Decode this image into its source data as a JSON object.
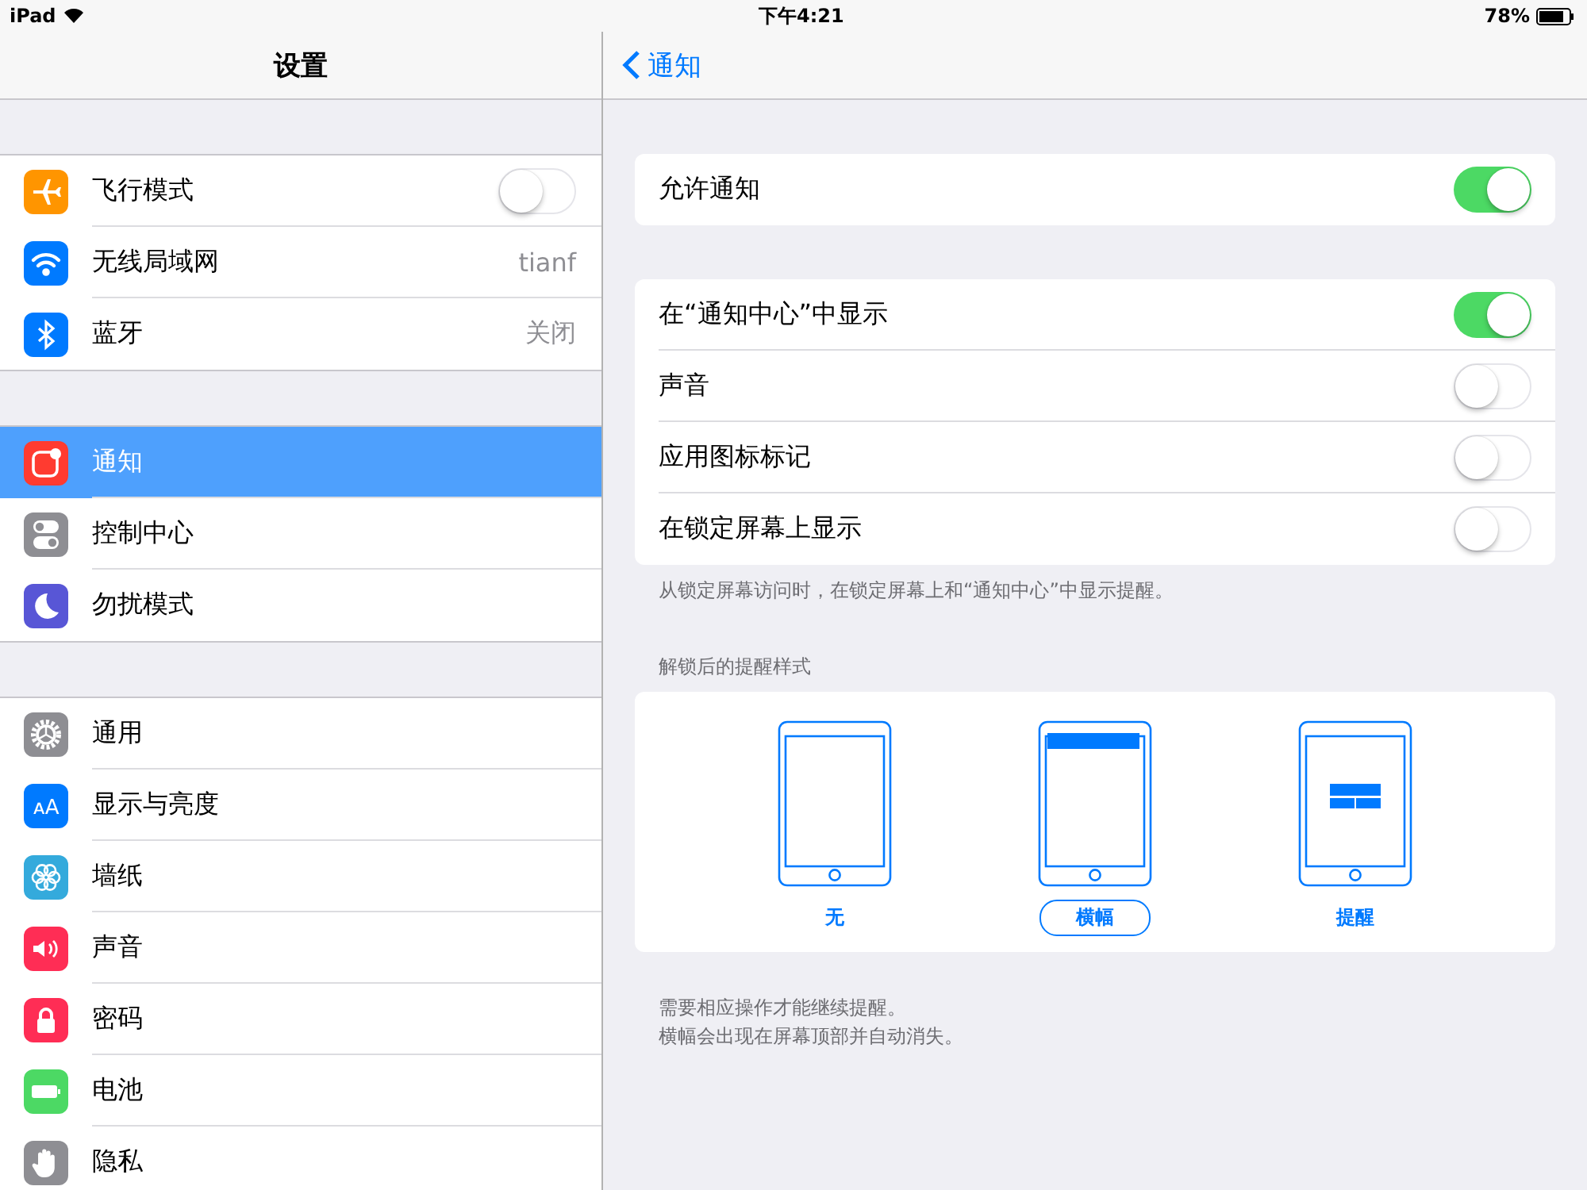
{
  "status_bar": {
    "device": "iPad",
    "time": "下午4:21",
    "battery": "78%"
  },
  "sidebar": {
    "title": "设置",
    "groups": [
      {
        "items": [
          {
            "label": "飞行模式",
            "kind": "toggle",
            "on": false,
            "selected": false,
            "color": "#ff9500"
          },
          {
            "label": "无线局域网",
            "kind": "detail",
            "value": "tianf",
            "selected": false,
            "color": "#007aff"
          },
          {
            "label": "蓝牙",
            "kind": "detail",
            "value": "关闭",
            "selected": false,
            "color": "#007aff"
          }
        ]
      },
      {
        "items": [
          {
            "label": "通知",
            "kind": "plain",
            "selected": true,
            "color": "#ff3b30"
          },
          {
            "label": "控制中心",
            "kind": "plain",
            "selected": false,
            "color": "#8e8e93"
          },
          {
            "label": "勿扰模式",
            "kind": "plain",
            "selected": false,
            "color": "#5856d6"
          }
        ]
      },
      {
        "items": [
          {
            "label": "通用",
            "kind": "plain",
            "selected": false,
            "color": "#8e8e93"
          },
          {
            "label": "显示与亮度",
            "kind": "plain",
            "selected": false,
            "color": "#007aff",
            "icon_text": "ᴀA"
          },
          {
            "label": "墙纸",
            "kind": "plain",
            "selected": false,
            "color": "#34aadc"
          },
          {
            "label": "声音",
            "kind": "plain",
            "selected": false,
            "color": "#ff2d55"
          },
          {
            "label": "密码",
            "kind": "plain",
            "selected": false,
            "color": "#ff2d55"
          },
          {
            "label": "电池",
            "kind": "plain",
            "selected": false,
            "color": "#4cd964"
          },
          {
            "label": "隐私",
            "kind": "plain",
            "selected": false,
            "color": "#8e8e93"
          }
        ]
      }
    ]
  },
  "detail": {
    "back": "通知",
    "groups": [
      {
        "rows": [
          {
            "label": "允许通知",
            "on": true
          }
        ]
      },
      {
        "rows": [
          {
            "label": "在“通知中心”中显示",
            "on": true
          },
          {
            "label": "声音",
            "on": false
          },
          {
            "label": "应用图标标记",
            "on": false
          },
          {
            "label": "在锁定屏幕上显示",
            "on": false
          }
        ],
        "footer": "从锁定屏幕访问时，在锁定屏幕上和“通知中心”中显示提醒。"
      }
    ],
    "alert_style": {
      "header": "解锁后的提醒样式",
      "options": [
        {
          "label": "无",
          "kind": "none",
          "selected": false
        },
        {
          "label": "横幅",
          "kind": "banner",
          "selected": true
        },
        {
          "label": "提醒",
          "kind": "alert",
          "selected": false
        }
      ],
      "footer": [
        "需要相应操作才能继续提醒。",
        "横幅会出现在屏幕顶部并自动消失。"
      ]
    }
  }
}
